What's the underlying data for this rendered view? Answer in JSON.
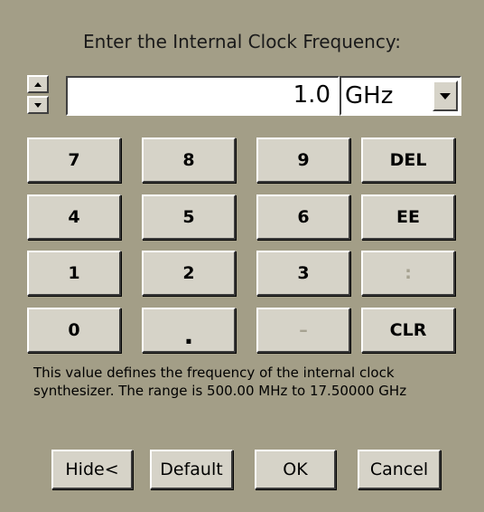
{
  "dialog": {
    "title": "Enter the Internal Clock Frequency:",
    "value": "1.0",
    "unit": "GHz",
    "keypad": [
      [
        "7",
        "8",
        "9",
        "DEL"
      ],
      [
        "4",
        "5",
        "6",
        "EE"
      ],
      [
        "1",
        "2",
        "3",
        ":"
      ],
      [
        "0",
        ".",
        "–",
        "CLR"
      ]
    ],
    "disabled_keys": [
      ":",
      "–"
    ],
    "description": "This value defines the frequency of the internal clock synthesizer.  The range is 500.00 MHz to 17.50000 GHz",
    "buttons": {
      "hide": "Hide<",
      "default": "Default",
      "ok": "OK",
      "cancel": "Cancel"
    },
    "colors": {
      "background": "#a39e87",
      "button_face": "#d6d3c8",
      "disabled_text": "#a6a291"
    }
  }
}
